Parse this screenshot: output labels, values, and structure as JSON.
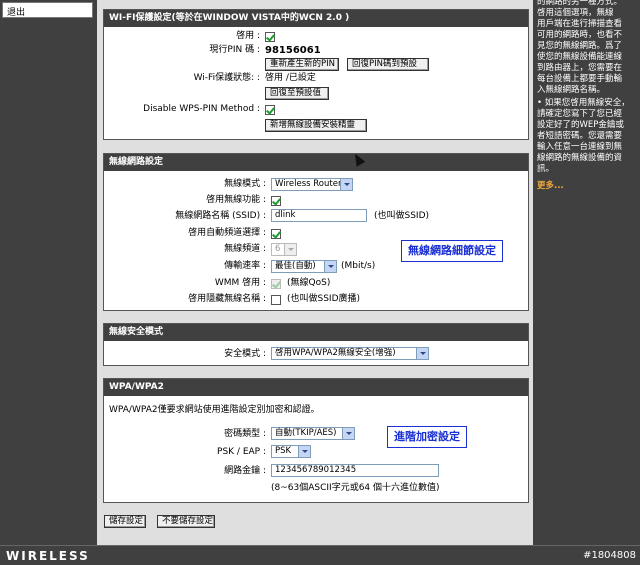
{
  "sidebar": {
    "nav_item": "退出"
  },
  "wps": {
    "heading": "WI-FI保護設定(等於在WINDOW VISTA中的WCN 2.0 )",
    "enable_label": "啓用 :",
    "pin_label": "現行PIN 碼 :",
    "pin_value": "98156061",
    "regen_pin_button": "重新產生新的PIN",
    "reset_pin_button": "回復PIN碼到預設",
    "status_label": "Wi-Fi保護狀態: :",
    "status_value": "啓用 /已設定",
    "reset_default_button": "回復至預設值",
    "disable_pin_label": "Disable WPS-PIN Method :",
    "add_wizard_button": "新增無線設備安裝精靈"
  },
  "wireless": {
    "heading": "無線網路設定",
    "mode_label": "無線模式 :",
    "mode_value": "Wireless Router",
    "enable_label": "啓用無線功能 :",
    "ssid_label": "無線網路名稱 (SSID) :",
    "ssid_value": "dlink",
    "ssid_note": "(也叫做SSID)",
    "auto_channel_label": "啓用自動頻道選擇 :",
    "channel_label": "無線頻道 :",
    "channel_value": "6",
    "rate_label": "傳輸速率 :",
    "rate_value": "最佳(自動)",
    "rate_unit": "(Mbit/s)",
    "wmm_label": "WMM 啓用 :",
    "wmm_note": "(無線QoS)",
    "hidden_label": "啓用隱藏無線名稱 :",
    "hidden_note": "(也叫做SSID廣播)",
    "callout": "無線網路細節設定"
  },
  "security": {
    "heading": "無線安全模式",
    "mode_label": "安全模式 :",
    "mode_value": "啓用WPA/WPA2無線安全(增強)"
  },
  "wpa": {
    "heading": "WPA/WPA2",
    "description": "WPA/WPA2僅要求網站使用進階設定別加密和認證。",
    "cipher_label": "密碼類型 :",
    "cipher_value": "自動(TKIP/AES)",
    "psk_label": "PSK / EAP :",
    "psk_value": "PSK",
    "key_label": "網路金鑰 :",
    "key_value": "123456789012345",
    "key_note": "(8~63個ASCII字元或64 個十六進位數值)",
    "callout": "進階加密設定"
  },
  "actions": {
    "save_button": "儲存設定",
    "nosave_button": "不要儲存設定"
  },
  "help": {
    "top_text": [
      "的網路的另一種方式。",
      "啓用這個選項，無線",
      "用戶端在進行掃描查看",
      "可用的網路時，也看不",
      "見您的無線網路。爲了",
      "使您的無線設備能連線",
      "到路由器上，您需要在",
      "每台設備上都要手動輸",
      "入無線網路名稱。"
    ],
    "mid_text": [
      "• 如果您啓用無線安全，",
      "請確定您寫下了您已經",
      "設定好了的WEP金鑰或",
      "者短語密碼。您還需要",
      "輸入任意一台連線到無",
      "線網路的無線設備的資",
      "訊。"
    ],
    "more_link": "更多..."
  },
  "footer": {
    "brand": "WIRELESS",
    "watermark": "#1804808"
  }
}
